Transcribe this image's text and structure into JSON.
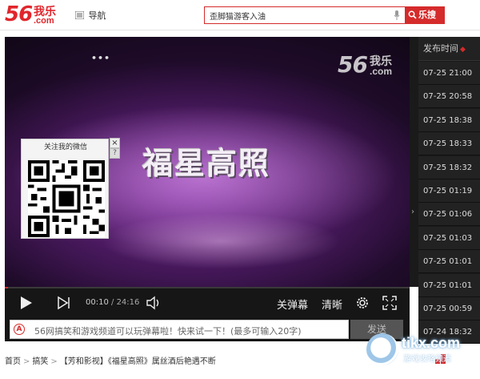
{
  "header": {
    "logo_number": "56",
    "logo_cn": "我乐",
    "logo_com": ".com",
    "nav_label": "导航",
    "search_value": "歪脚猫游客入油",
    "search_button": "乐搜"
  },
  "player": {
    "video_title_art": "福星高照",
    "watermark_number": "56",
    "watermark_cn": "我乐",
    "watermark_com": ".com",
    "qr_title": "关注我的微信",
    "qr_close": "×",
    "qr_help": "?",
    "time_current": "00:10",
    "time_sep": " / ",
    "time_total": "24:16",
    "progress": 0.007,
    "danmu_off": "关弹幕",
    "quality": "清晰",
    "danmu_placeholder": "56网搞笑和游戏频道可以玩弹幕啦！快来试一下！(最多可输入20字)",
    "danmu_icon": "A",
    "send_label": "发送"
  },
  "episode_list": {
    "header": "发布时间",
    "items": [
      "07-25 21:00",
      "07-25 20:58",
      "07-25 18:38",
      "07-25 18:33",
      "07-25 18:32",
      "07-25 01:19",
      "07-25 01:06",
      "07-25 01:03",
      "07-25 01:01",
      "07-25 01:01",
      "07-25 00:59",
      "07-24 18:32"
    ]
  },
  "breadcrumb": {
    "home": "首页",
    "category": "搞笑",
    "path": "【芳和影视】《福星高照》属丝酒后艳遇不断"
  },
  "watermark_site": {
    "name": "tikx.com",
    "sub": "游戏攻略频道"
  },
  "colors": {
    "brand_red": "#d52b2b",
    "player_bg": "#161616"
  }
}
